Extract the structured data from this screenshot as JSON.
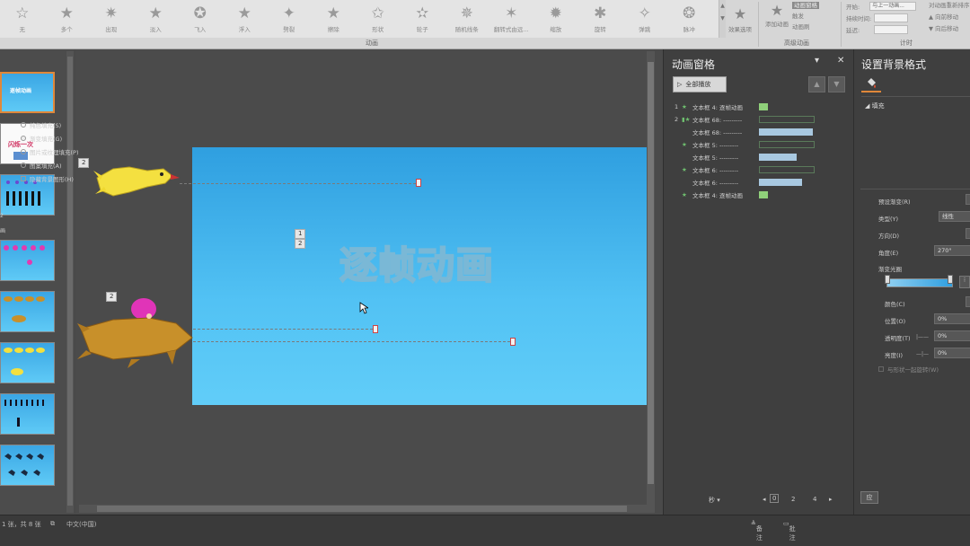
{
  "ribbon": {
    "effects": [
      "无",
      "多个",
      "出现",
      "淡入",
      "飞入",
      "浮入",
      "劈裂",
      "擦除",
      "形状",
      "轮子",
      "随机线条",
      "翻转式由远...",
      "缩放",
      "旋转",
      "弹跳",
      "脉冲"
    ],
    "group_anim": "动画",
    "effect_options": "效果选项",
    "add_anim": "添加动画",
    "anim_pane_btn": "动画窗格",
    "trigger": "触发",
    "anim_painter": "动画刷",
    "group_adv": "高级动画",
    "start_label": "开始:",
    "start_value": "与上一动画...",
    "duration_label": "持续时间:",
    "delay_label": "延迟:",
    "group_timing": "计时",
    "reorder_title": "对动画重新排序",
    "move_earlier": "向前移动",
    "move_later": "向后移动"
  },
  "thumbnails": {
    "slide1_title": "逐帧动画",
    "slide2_title": "闪烁一次",
    "num_label_1": "2",
    "num_label_2": "画"
  },
  "slide": {
    "title": "逐帧动画",
    "tag_bird": "2",
    "tag_mid_1": "1",
    "tag_mid_2": "2",
    "tag_lion": "2"
  },
  "anim_pane": {
    "title": "动画窗格",
    "play_all": "全部播放",
    "rows": [
      {
        "num": "1",
        "name": "文本框 4: 逐帧动画"
      },
      {
        "num": "2",
        "name": "文本框 68: ---------"
      },
      {
        "num": "",
        "name": "文本框 68: ---------"
      },
      {
        "num": "",
        "name": "文本框 5: ---------"
      },
      {
        "num": "",
        "name": "文本框 5: ---------"
      },
      {
        "num": "",
        "name": "文本框 6: ---------"
      },
      {
        "num": "",
        "name": "文本框 6: ---------"
      },
      {
        "num": "",
        "name": "文本框 4: 逐帧动画"
      }
    ],
    "seconds": "秒",
    "timeline": [
      "0",
      "2",
      "4"
    ]
  },
  "format_pane": {
    "title": "设置背景格式",
    "fill_header": "填充",
    "options": [
      "纯色填充(S)",
      "渐变填充(G)",
      "图片或纹理填充(P)",
      "图案填充(A)"
    ],
    "hide_bg": "隐藏背景图形(H)",
    "preset": "预设渐变(R)",
    "type_label": "类型(Y)",
    "type_value": "线性",
    "direction": "方向(D)",
    "angle_label": "角度(E)",
    "angle_value": "270°",
    "stops_label": "渐变光圈",
    "color_label": "颜色(C)",
    "position_label": "位置(O)",
    "position_value": "0%",
    "transparency_label": "透明度(T)",
    "transparency_value": "0%",
    "brightness_label": "亮度(I)",
    "brightness_value": "0%",
    "rotate_with_shape": "与形状一起旋转(W)",
    "apply_btn": "应"
  },
  "status": {
    "slide_count": "1 张，共 8 张",
    "language": "中文(中国)",
    "notes": "备注",
    "comments": "批注"
  },
  "colors": {
    "slide_top": "#2f9fe0",
    "slide_bottom": "#61cdf8",
    "accent": "#e0883a"
  }
}
